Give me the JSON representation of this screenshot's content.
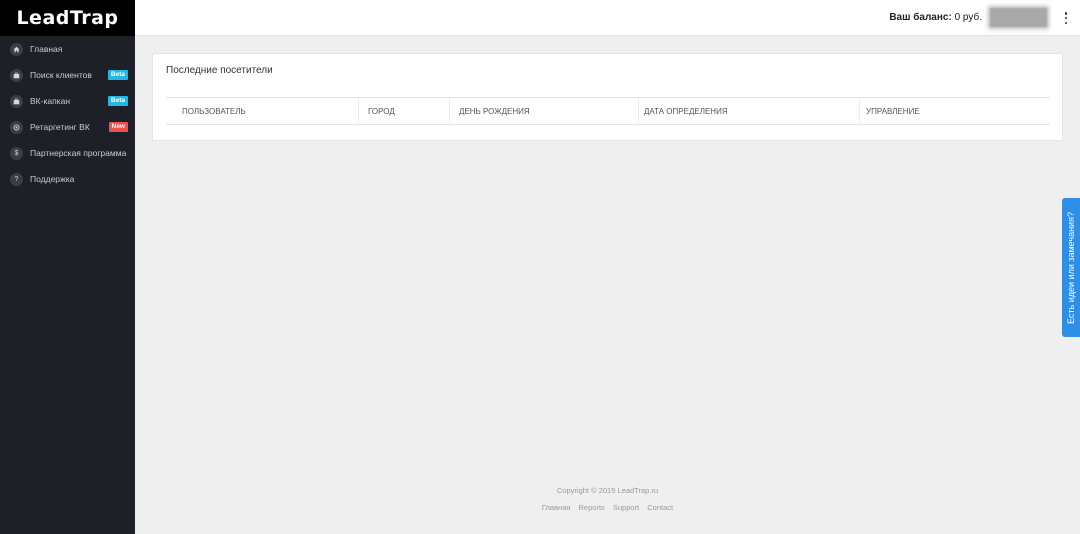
{
  "brand": {
    "logo": "LeadTrap"
  },
  "sidebar": {
    "items": [
      {
        "label": "Главная",
        "icon": "home-icon",
        "badge": ""
      },
      {
        "label": "Поиск клиентов",
        "icon": "briefcase-icon",
        "badge": "Beta",
        "badge_color": "#23b7e5"
      },
      {
        "label": "ВК-капкан",
        "icon": "briefcase-icon",
        "badge": "Beta",
        "badge_color": "#23b7e5"
      },
      {
        "label": "Ретаргетинг ВК",
        "icon": "target-icon",
        "badge": "New",
        "badge_color": "#f05050"
      },
      {
        "label": "Партнерская программа",
        "icon": "dollar-icon",
        "badge": ""
      },
      {
        "label": "Поддержка",
        "icon": "question-icon",
        "badge": ""
      }
    ]
  },
  "header": {
    "balance_label": "Ваш баланс:",
    "balance_value": "0 руб."
  },
  "main": {
    "card_title": "Последние посетители",
    "columns": [
      "Пользователь",
      "Город",
      "День рождения",
      "Дата определения",
      "Управление"
    ]
  },
  "feedback": {
    "label": "Есть идеи или замечания?"
  },
  "footer": {
    "copyright": "Copyright © 2015 LeadTrap.ru",
    "links": [
      "Главная",
      "Reports",
      "Support",
      "Contact"
    ]
  },
  "colors": {
    "sidebar_bg": "#1d2027",
    "accent_blue": "#2d8fe5",
    "badge_beta": "#23b7e5",
    "badge_new": "#f05050"
  }
}
